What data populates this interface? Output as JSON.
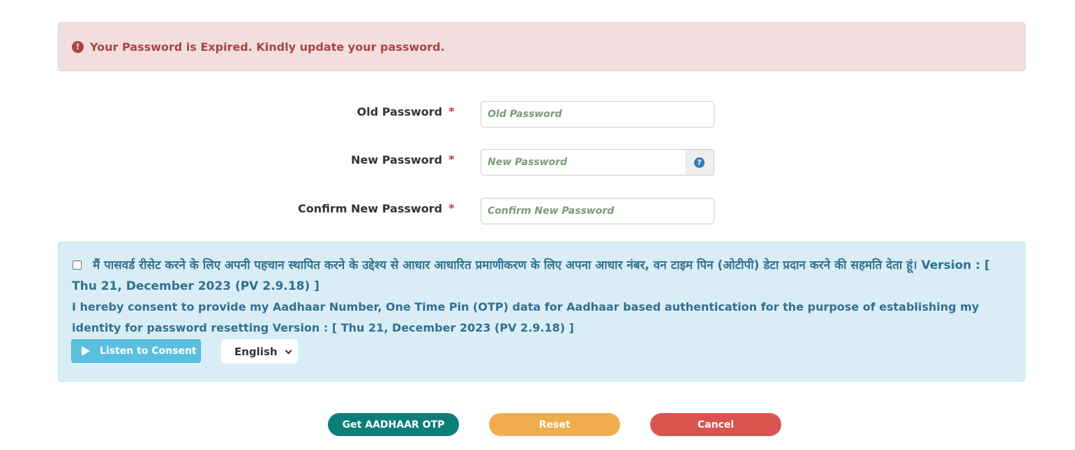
{
  "alert": {
    "icon": "exclamation-circle-icon",
    "message": "Your Password is Expired. Kindly update your password.",
    "color": "#a94442",
    "background": "#f2dede"
  },
  "form": {
    "old_password": {
      "label": "Old Password",
      "required_mark": "*",
      "placeholder": "Old Password",
      "value": ""
    },
    "new_password": {
      "label": "New Password",
      "required_mark": "*",
      "placeholder": "New Password",
      "value": "",
      "help_icon": "question-circle-icon"
    },
    "confirm_password": {
      "label": "Confirm New Password",
      "required_mark": "*",
      "placeholder": "Confirm New Password",
      "value": ""
    }
  },
  "consent": {
    "checked": false,
    "hindi_text": "मैं पासवर्ड रीसेट करने के लिए अपनी पहचान स्थापित करने के उद्देश्य से आधार आधारित प्रमाणीकरण के लिए अपना आधार नंबर, वन टाइम पिन (ओटीपी) डेटा प्रदान करने की सहमति देता हूं। Version : [ Thu 21, December 2023 (PV 2.9.18) ]",
    "english_text": "I hereby consent to provide my Aadhaar Number, One Time Pin (OTP) data for Aadhaar based authentication for the purpose of establishing my identity for password resetting Version : [ Thu 21, December 2023 (PV 2.9.18) ]",
    "listen_label": "Listen to Consent",
    "listen_icon": "play-icon",
    "language_selected": "English",
    "language_icon": "chevron-down-icon",
    "color": "#31708f",
    "background": "#d9edf7"
  },
  "actions": {
    "otp_label": "Get AADHAAR OTP",
    "reset_label": "Reset",
    "cancel_label": "Cancel",
    "otp_color": "#0a7f7a",
    "reset_color": "#f0ad4e",
    "cancel_color": "#d9534f"
  }
}
